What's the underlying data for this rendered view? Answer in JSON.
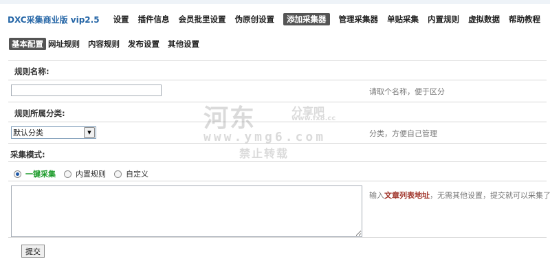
{
  "nav": {
    "brand": "DXC采集商业版 vip2.5",
    "items": [
      "设置",
      "插件信息",
      "会员批里设置",
      "伪原创设置",
      "添加采集器",
      "管理采集器",
      "单贴采集",
      "内置规则",
      "虚拟数据",
      "帮助教程"
    ],
    "active_index": 4
  },
  "subnav": {
    "items": [
      "基本配置",
      "网址规则",
      "内容规则",
      "发布设置",
      "其他设置"
    ],
    "active_index": 0
  },
  "form": {
    "rule_name_label": "规则名称:",
    "rule_name_value": "",
    "rule_name_hint": "请取个名称，便于区分",
    "category_label": "规则所属分类:",
    "category_selected": "默认分类",
    "category_hint": "分类，方便自己管理",
    "mode_label": "采集模式:",
    "modes": [
      "一键采集",
      "内置规则",
      "自定义"
    ],
    "mode_selected_index": 0,
    "list_hint_pre": "输入",
    "list_hint_em": "文章列表地址",
    "list_hint_post": "，无需其他设置，提交就可以采集了。",
    "list_value": "",
    "submit_label": "提交"
  },
  "watermark": {
    "main": "河东",
    "share": "分享吧",
    "small": "www.fx8.cc",
    "url": "www.ymg6.com",
    "forbid": "禁止转载"
  },
  "colors": {
    "brand": "#2465a6",
    "active_tab_bg": "#555555",
    "selected_mode": "#1a9a28",
    "hint_emphasis": "#a0342a"
  }
}
